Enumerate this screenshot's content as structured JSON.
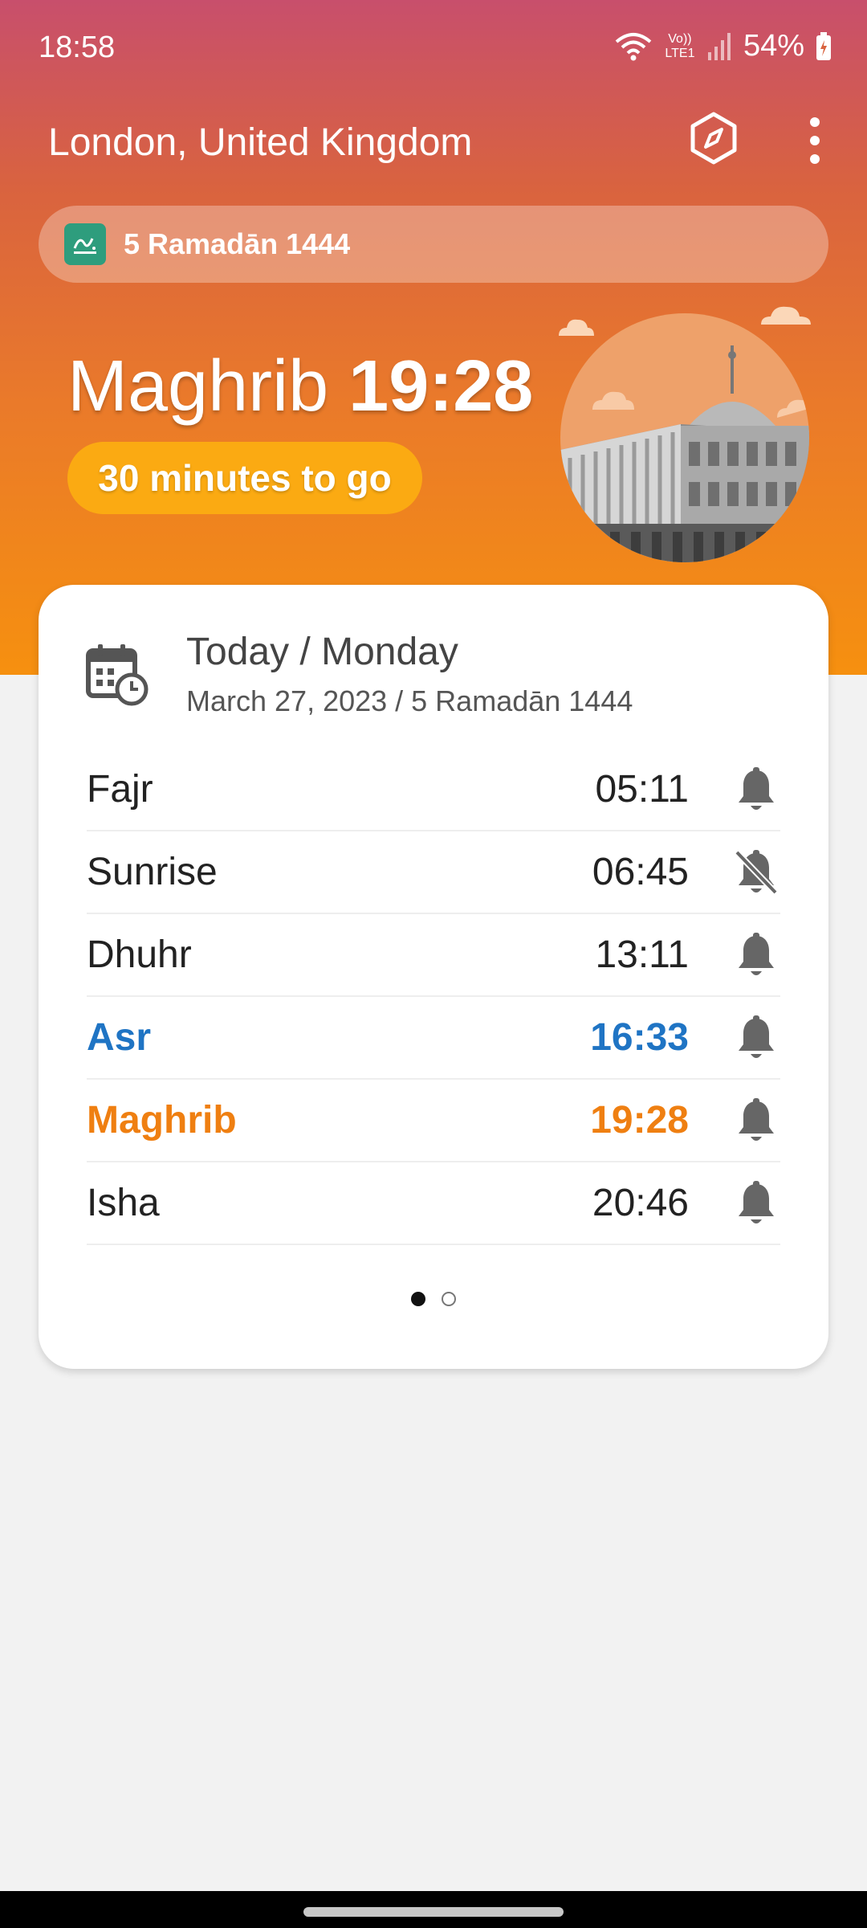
{
  "status_bar": {
    "time": "18:58",
    "network": "Vo)) LTE1",
    "battery": "54%"
  },
  "appbar": {
    "location": "London, United Kingdom",
    "compass_icon": "compass-icon",
    "menu_icon": "more-vert-icon"
  },
  "hijri": {
    "date": "5 Ramadān 1444",
    "icon": "hijri-calendar-icon"
  },
  "next_prayer": {
    "name": "Maghrib",
    "time": "19:28",
    "countdown": "30 minutes to go"
  },
  "card": {
    "title": "Today / Monday",
    "subtitle": "March 27, 2023 / 5 Ramadān 1444",
    "prayers": [
      {
        "name": "Fajr",
        "time": "05:11",
        "alarm": "on"
      },
      {
        "name": "Sunrise",
        "time": "06:45",
        "alarm": "off"
      },
      {
        "name": "Dhuhr",
        "time": "13:11",
        "alarm": "on"
      },
      {
        "name": "Asr",
        "time": "16:33",
        "alarm": "on",
        "state": "current"
      },
      {
        "name": "Maghrib",
        "time": "19:28",
        "alarm": "on",
        "state": "next"
      },
      {
        "name": "Isha",
        "time": "20:46",
        "alarm": "on"
      }
    ],
    "pager": {
      "page": 1,
      "total": 2
    }
  },
  "colors": {
    "current_prayer": "#1f74c4",
    "next_prayer": "#ef7f11",
    "countdown_pill": "#fbaa12"
  }
}
